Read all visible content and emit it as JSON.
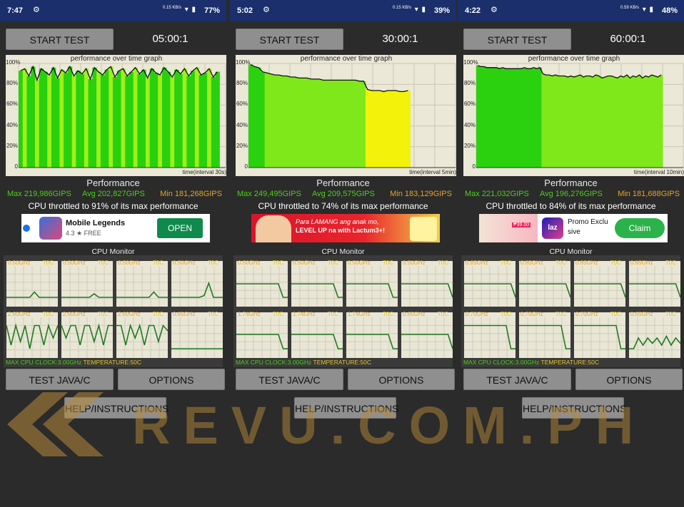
{
  "ui": {
    "start_test_label": "START TEST",
    "graph_title": "performance over time graph",
    "y_ticks": [
      "100%",
      "80%",
      "60%",
      "40%",
      "20%",
      "0"
    ],
    "performance_title": "Performance",
    "cpu_monitor_title": "CPU Monitor",
    "test_java_label": "TEST JAVA/C",
    "options_label": "OPTIONS",
    "help_label": "HELP/INSTRUCTIONS",
    "max_cpu_clock": "MAX CPU CLOCK:3.00GHz",
    "temperature": "TEMPERATURE:50C",
    "core_temp": "T0C"
  },
  "colors": {
    "status_bar": "#1a2f6b",
    "graph_bg": "#ebe8d8",
    "green": "#2bd10f",
    "yellow": "#f2f20a",
    "min_color": "#e2a52b"
  },
  "watermark": {
    "text": "REVU.COM.PH"
  },
  "screens": [
    {
      "status": {
        "time": "7:47",
        "battery": "77%",
        "speed": "0.15 KB/s"
      },
      "timer": "05:00:1",
      "interval_label": "time(interval 30s)",
      "stats": {
        "max": "Max 219,986GIPS",
        "avg": "Avg 202,827GIPS",
        "min": "Min 181,268GIPS"
      },
      "throttle": "CPU throttled to 91% of its max performance",
      "graph_series": [
        93,
        95,
        88,
        97,
        84,
        95,
        92,
        89,
        96,
        86,
        94,
        91,
        97,
        88,
        93,
        90,
        95,
        85,
        96,
        92,
        89,
        94,
        97,
        87,
        93,
        95,
        88,
        92,
        96,
        90,
        94,
        86,
        95,
        91,
        89,
        96,
        92,
        87,
        94,
        90,
        95,
        88,
        93,
        96,
        89,
        91,
        95,
        87,
        92
      ],
      "graph_fill_fraction": 0.97,
      "ad": {
        "type": "app",
        "title": "Mobile Legends",
        "rating": "4.3 ★  FREE",
        "cta": "OPEN"
      },
      "cores": [
        {
          "freq": "0.50GHz",
          "level": [
            0.2,
            0.2,
            0.2,
            0.2,
            0.2,
            0.2,
            0.35,
            0.2,
            0.2,
            0.2,
            0.2,
            0.2
          ]
        },
        {
          "freq": "0.50GHz",
          "level": [
            0.2,
            0.2,
            0.2,
            0.2,
            0.2,
            0.2,
            0.2,
            0.3,
            0.2,
            0.2,
            0.2,
            0.2
          ]
        },
        {
          "freq": "0.50GHz",
          "level": [
            0.2,
            0.2,
            0.2,
            0.2,
            0.2,
            0.2,
            0.2,
            0.2,
            0.35,
            0.2,
            0.2,
            0.2
          ]
        },
        {
          "freq": "0.50GHz",
          "level": [
            0.2,
            0.2,
            0.2,
            0.2,
            0.2,
            0.2,
            0.2,
            0.25,
            0.6,
            0.2,
            0.2,
            0.2
          ]
        },
        {
          "freq": "2.60GHz",
          "level": [
            0.85,
            0.3,
            0.85,
            0.4,
            0.85,
            0.2,
            0.85,
            0.85,
            0.3,
            0.85,
            0.5,
            0.85
          ]
        },
        {
          "freq": "2.60GHz",
          "level": [
            0.85,
            0.5,
            0.85,
            0.85,
            0.3,
            0.85,
            0.85,
            0.4,
            0.85,
            0.3,
            0.85,
            0.85
          ]
        },
        {
          "freq": "2.60GHz",
          "level": [
            0.85,
            0.85,
            0.3,
            0.85,
            0.5,
            0.85,
            0.3,
            0.85,
            0.85,
            0.4,
            0.85,
            0.7
          ]
        },
        {
          "freq": "0.65GHz",
          "level": [
            0.2,
            0.2,
            0.2,
            0.2,
            0.2,
            0.2,
            0.2,
            0.2,
            0.2,
            0.2,
            0.2,
            0.2
          ]
        }
      ]
    },
    {
      "status": {
        "time": "5:02",
        "battery": "39%",
        "speed": "0.15 KB/s"
      },
      "timer": "30:00:1",
      "interval_label": "time(interval 5min)",
      "stats": {
        "max": "Max 249,495GIPS",
        "avg": "Avg 209,575GIPS",
        "min": "Min 183,129GIPS"
      },
      "throttle": "CPU throttled to 74% of its max performance",
      "graph_series": [
        99,
        97,
        96,
        92,
        91,
        90,
        89,
        89,
        88,
        88,
        87,
        87,
        86,
        86,
        86,
        85,
        85,
        85,
        84,
        84,
        84,
        84,
        84,
        84,
        84,
        84,
        84,
        83,
        83,
        75,
        74,
        74,
        74,
        73,
        74,
        74,
        74,
        73,
        73,
        74
      ],
      "graph_fill_fraction": 0.78,
      "ad": {
        "type": "banner",
        "line1": "Para LAMANG ang anak mo,",
        "line2": "LEVEL UP na with Lactum3+!"
      },
      "cores": [
        {
          "freq": "0.50GHz",
          "level": [
            0.58,
            0.58,
            0.58,
            0.58,
            0.58,
            0.58,
            0.58,
            0.58,
            0.58,
            0.58,
            0.2,
            0.2
          ]
        },
        {
          "freq": "0.50GHz",
          "level": [
            0.58,
            0.58,
            0.58,
            0.58,
            0.58,
            0.58,
            0.58,
            0.58,
            0.58,
            0.58,
            0.2,
            0.2
          ]
        },
        {
          "freq": "0.50GHz",
          "level": [
            0.58,
            0.58,
            0.58,
            0.58,
            0.58,
            0.58,
            0.58,
            0.58,
            0.58,
            0.58,
            0.2,
            0.2
          ]
        },
        {
          "freq": "0.50GHz",
          "level": [
            0.58,
            0.58,
            0.58,
            0.58,
            0.58,
            0.58,
            0.58,
            0.58,
            0.58,
            0.58,
            0.58,
            0.2
          ]
        },
        {
          "freq": "1.74GHz",
          "level": [
            0.6,
            0.6,
            0.6,
            0.6,
            0.6,
            0.6,
            0.6,
            0.6,
            0.6,
            0.6,
            0.2,
            0.2
          ]
        },
        {
          "freq": "1.74GHz",
          "level": [
            0.6,
            0.6,
            0.6,
            0.6,
            0.6,
            0.6,
            0.6,
            0.6,
            0.6,
            0.6,
            0.2,
            0.2
          ]
        },
        {
          "freq": "1.74GHz",
          "level": [
            0.6,
            0.6,
            0.6,
            0.6,
            0.6,
            0.6,
            0.6,
            0.6,
            0.6,
            0.6,
            0.2,
            0.2
          ]
        },
        {
          "freq": "0.65GHz",
          "level": [
            0.6,
            0.6,
            0.6,
            0.6,
            0.6,
            0.6,
            0.6,
            0.6,
            0.6,
            0.6,
            0.6,
            0.2
          ]
        }
      ]
    },
    {
      "status": {
        "time": "4:22",
        "battery": "48%",
        "speed": "0.59 KB/s"
      },
      "timer": "60:00:1",
      "interval_label": "time(interval 10min)",
      "stats": {
        "max": "Max 221,032GIPS",
        "avg": "Avg 196,276GIPS",
        "min": "Min 181,688GIPS"
      },
      "throttle": "CPU throttled to 84% of its max performance",
      "graph_series": [
        98,
        97,
        97,
        96,
        96,
        96,
        96,
        95,
        96,
        95,
        95,
        95,
        95,
        95,
        95,
        96,
        95,
        95,
        96,
        95,
        96,
        90,
        89,
        89,
        88,
        89,
        88,
        88,
        88,
        87,
        88,
        87,
        88,
        89,
        87,
        88,
        88,
        87,
        89,
        88,
        86,
        87,
        88,
        88,
        87,
        86,
        88,
        87,
        89,
        86,
        88,
        87,
        89,
        86,
        88,
        87,
        89,
        88,
        87,
        89
      ],
      "graph_fill_fraction": 0.9,
      "ad": {
        "type": "laz",
        "title": "Promo Exclu sive",
        "cta": "Claim",
        "price": "₱39.00"
      },
      "cores": [
        {
          "freq": "0.85GHz",
          "level": [
            0.58,
            0.58,
            0.58,
            0.58,
            0.58,
            0.58,
            0.58,
            0.58,
            0.58,
            0.58,
            0.58,
            0.2
          ]
        },
        {
          "freq": "0.85GHz",
          "level": [
            0.58,
            0.58,
            0.58,
            0.58,
            0.58,
            0.58,
            0.58,
            0.58,
            0.58,
            0.58,
            0.58,
            0.2
          ]
        },
        {
          "freq": "0.85GHz",
          "level": [
            0.58,
            0.58,
            0.58,
            0.58,
            0.58,
            0.58,
            0.58,
            0.58,
            0.58,
            0.58,
            0.58,
            0.2
          ]
        },
        {
          "freq": "0.85GHz",
          "level": [
            0.58,
            0.58,
            0.58,
            0.58,
            0.58,
            0.58,
            0.58,
            0.58,
            0.58,
            0.58,
            0.58,
            0.2
          ]
        },
        {
          "freq": "0.70GHz",
          "level": [
            0.85,
            0.85,
            0.85,
            0.85,
            0.85,
            0.85,
            0.85,
            0.85,
            0.85,
            0.85,
            0.2,
            0.2
          ]
        },
        {
          "freq": "0.70GHz",
          "level": [
            0.85,
            0.85,
            0.85,
            0.85,
            0.85,
            0.85,
            0.85,
            0.85,
            0.85,
            0.85,
            0.2,
            0.2
          ]
        },
        {
          "freq": "0.70GHz",
          "level": [
            0.85,
            0.85,
            0.85,
            0.85,
            0.85,
            0.85,
            0.85,
            0.85,
            0.85,
            0.85,
            0.2,
            0.2
          ]
        },
        {
          "freq": "0.65GHz",
          "level": [
            0.2,
            0.2,
            0.5,
            0.3,
            0.5,
            0.35,
            0.5,
            0.3,
            0.55,
            0.3,
            0.5,
            0.35
          ]
        }
      ]
    }
  ]
}
